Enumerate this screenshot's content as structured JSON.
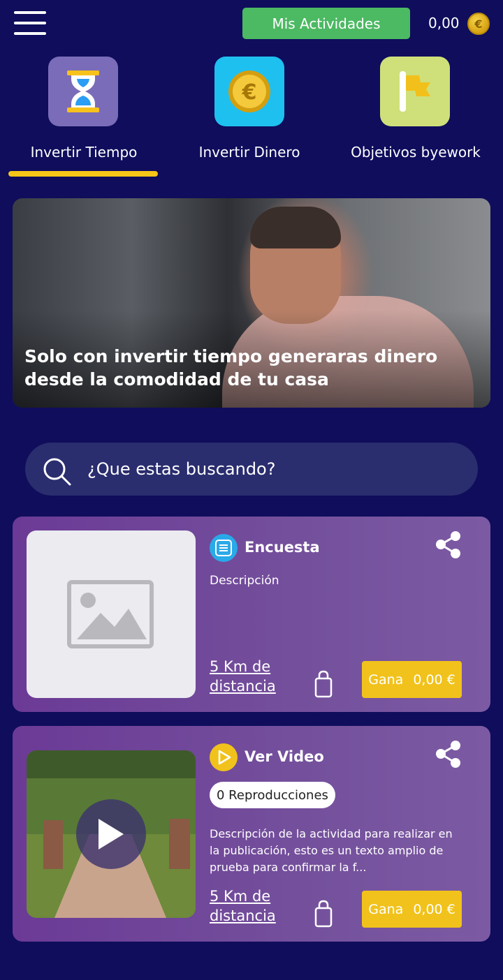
{
  "header": {
    "activities_label": "Mis Actividades",
    "balance": "0,00",
    "coin_symbol": "€"
  },
  "categories": [
    {
      "label": "Invertir Tiempo",
      "icon": "hourglass-icon",
      "color": "#7a6cb8",
      "active": true
    },
    {
      "label": "Invertir Dinero",
      "icon": "euro-coin-icon",
      "color": "#1ec0f0",
      "active": false
    },
    {
      "label": "Objetivos byework",
      "icon": "flag-icon",
      "color": "#cfe07a",
      "active": false
    }
  ],
  "banner": {
    "text": "Solo con invertir tiempo generaras dinero desde la comodidad de tu casa"
  },
  "search": {
    "placeholder": "¿Que estas buscando?"
  },
  "activities": [
    {
      "type_icon": "list-icon",
      "title": "Encuesta",
      "description": "Descripción",
      "distance_line1": "5 Km de",
      "distance_line2": "distancia",
      "earn_label": "Gana",
      "earn_amount": "0,00 €"
    },
    {
      "type_icon": "play-icon",
      "title": "Ver Video",
      "views": "0 Reproducciones",
      "description": "Descripción de la actividad para realizar en la publicación, esto es un texto amplio de prueba para confirmar la f...",
      "distance_line1": "5 Km de",
      "distance_line2": "distancia",
      "earn_label": "Gana",
      "earn_amount": "0,00 €"
    }
  ],
  "colors": {
    "background": "#0f0d5c",
    "accent_green": "#4cb963",
    "tab_underline": "#f5c518",
    "earn_button": "#f1c21b",
    "card": "#6b3a96",
    "search_bg": "#2a2d6e"
  }
}
